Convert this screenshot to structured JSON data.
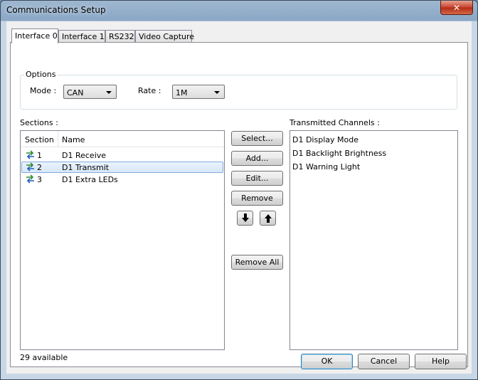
{
  "window": {
    "title": "Communications Setup",
    "close_glyph": "✕"
  },
  "tabs": [
    "Interface 0",
    "Interface 1",
    "RS232",
    "Video Capture"
  ],
  "options": {
    "caption": "Options",
    "mode_label": "Mode :",
    "mode_value": "CAN",
    "rate_label": "Rate :",
    "rate_value": "1M"
  },
  "sections": {
    "label": "Sections :",
    "columns": [
      "Section",
      "Name"
    ],
    "rows": [
      {
        "num": "1",
        "name": "D1 Receive",
        "icon": "bidirectional-arrows-icon",
        "selected": false
      },
      {
        "num": "2",
        "name": "D1 Transmit",
        "icon": "bidirectional-arrows-icon",
        "selected": true
      },
      {
        "num": "3",
        "name": "D1 Extra LEDs",
        "icon": "bidirectional-arrows-icon",
        "selected": false
      }
    ],
    "available": "29 available"
  },
  "actions": {
    "select": "Select...",
    "add": "Add...",
    "edit": "Edit...",
    "remove": "Remove",
    "move_down_icon": "arrow-down-icon",
    "move_up_icon": "arrow-up-icon",
    "remove_all": "Remove All"
  },
  "channels": {
    "label": "Transmitted Channels :",
    "items": [
      "D1 Display Mode",
      "D1 Backlight Brightness",
      "D1 Warning Light"
    ]
  },
  "footer": {
    "ok": "OK",
    "cancel": "Cancel",
    "help": "Help"
  },
  "colors": {
    "selection_border": "#84acdd",
    "icon_green": "#2e8b2e",
    "icon_blue": "#1f5fbf"
  }
}
